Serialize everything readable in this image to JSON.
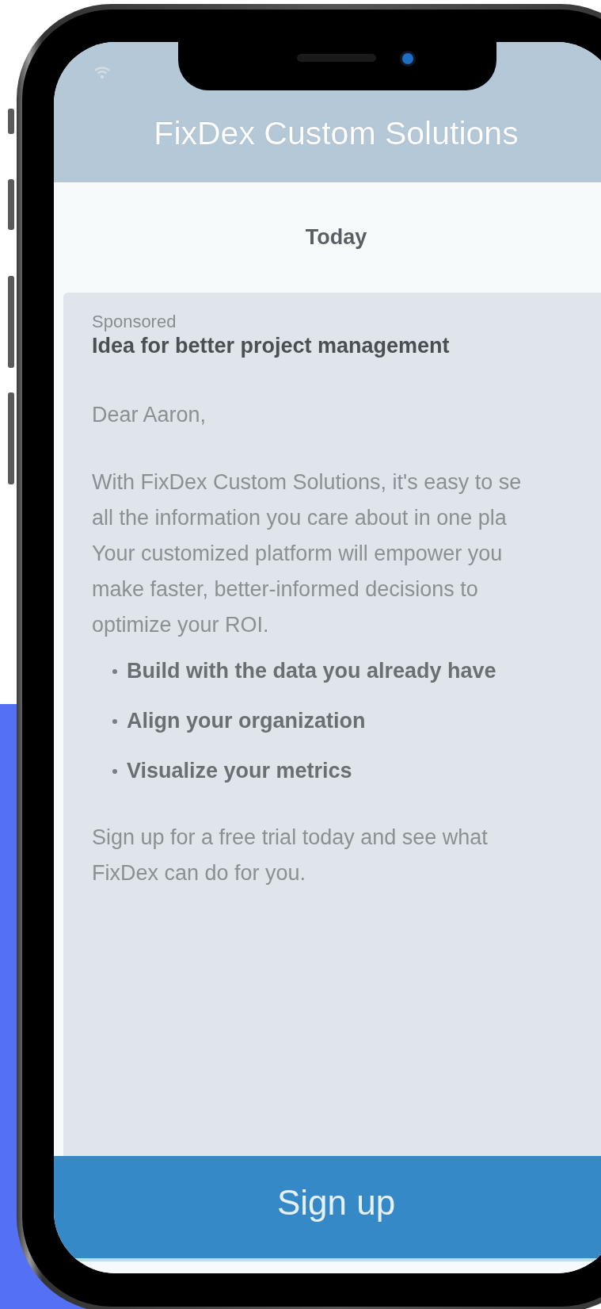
{
  "header": {
    "title": "FixDex Custom Solutions"
  },
  "date_heading": "Today",
  "message": {
    "label": "Sponsored",
    "subject": "Idea for better project management",
    "greeting": "Dear Aaron,",
    "body_lines": [
      "With FixDex Custom Solutions, it's easy to se",
      "all the information you care about in one pla",
      "Your customized platform will empower you",
      "make faster, better-informed decisions to",
      "optimize your ROI."
    ],
    "bullets": [
      "Build with the data you already have",
      "Align your organization",
      "Visualize your metrics"
    ],
    "closing": "Sign up for a free trial today and see what FixDex can do for you."
  },
  "button": "Sign up"
}
